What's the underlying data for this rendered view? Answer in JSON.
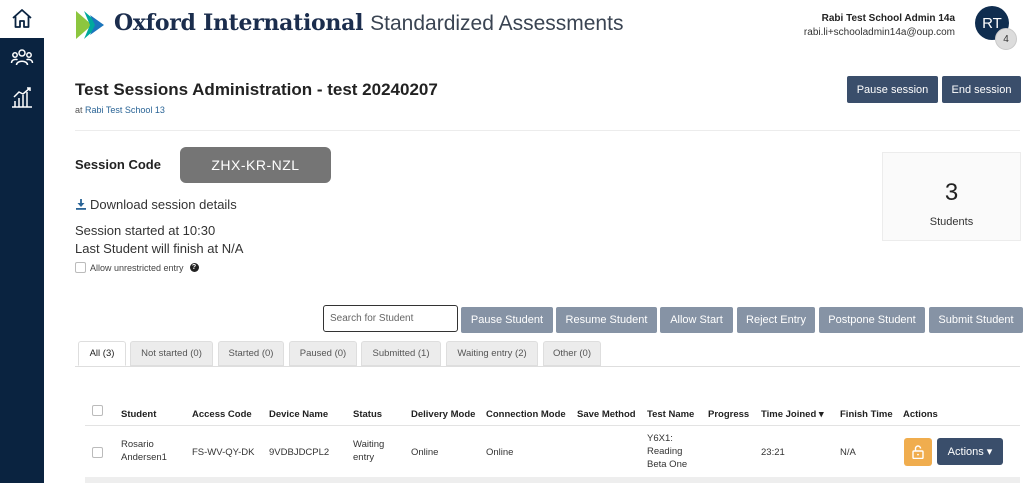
{
  "sidebar": {
    "items": [
      {
        "name": "home-icon"
      },
      {
        "name": "group-icon"
      },
      {
        "name": "chart-icon"
      }
    ]
  },
  "header": {
    "brand_bold": "Oxford International",
    "brand_light": "Standardized Assessments",
    "user_name": "Rabi Test School Admin 14a",
    "user_email": "rabi.li+schooladmin14a@oup.com",
    "avatar_initials": "RT",
    "avatar_badge": "4"
  },
  "session": {
    "title": "Test Sessions Administration - test 20240207",
    "at_label": "at",
    "school": "Rabi Test School 13",
    "pause_label": "Pause session",
    "end_label": "End session",
    "code_label": "Session Code",
    "code": "ZHX-KR-NZL",
    "download_label": "Download session details",
    "started_text": "Session started at 10:30",
    "finish_text": "Last Student will finish at N/A",
    "unrestricted_label": "Allow unrestricted entry",
    "students_count": "3",
    "students_label": "Students"
  },
  "toolbar": {
    "search_placeholder": "Search for Student",
    "pause_student": "Pause Student",
    "resume_student": "Resume Student",
    "allow_start": "Allow Start",
    "reject_entry": "Reject Entry",
    "postpone_student": "Postpone Student",
    "submit_student": "Submit Student"
  },
  "tabs": [
    {
      "label": "All (3)",
      "active": true
    },
    {
      "label": "Not started (0)"
    },
    {
      "label": "Started (0)"
    },
    {
      "label": "Paused (0)"
    },
    {
      "label": "Submitted (1)"
    },
    {
      "label": "Waiting entry (2)"
    },
    {
      "label": "Other (0)"
    }
  ],
  "table": {
    "headers": [
      "Student",
      "Access Code",
      "Device Name",
      "Status",
      "Delivery Mode",
      "Connection Mode",
      "Save Method",
      "Test Name",
      "Progress",
      "Time Joined ▾",
      "Finish Time",
      "Actions"
    ],
    "rows": [
      {
        "student": "Rosario Andersen1",
        "access_code": "FS-WV-QY-DK",
        "device": "9VDBJDCPL2",
        "status": "Waiting entry",
        "delivery": "Online",
        "connection": "Online",
        "save_method": "",
        "test_name": "Y6X1: Reading Beta One",
        "progress": "",
        "time_joined": "23:21",
        "finish_time": "N/A",
        "actions_label": "Actions ▾"
      }
    ]
  },
  "colors": {
    "sidebar": "#0a2340",
    "primary_button": "#3a4e6b",
    "secondary_button": "#8693a5",
    "session_code_bg": "#757575",
    "unlock_button": "#f0ad4e"
  }
}
